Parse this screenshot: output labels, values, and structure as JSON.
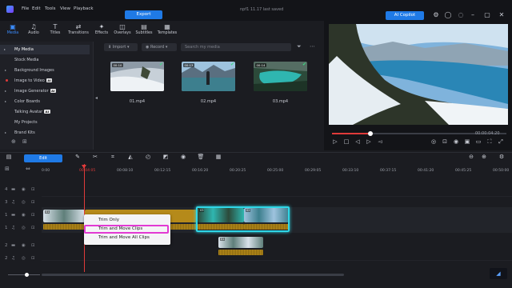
{
  "app": {
    "menu": [
      "File",
      "Edit",
      "Tools",
      "View",
      "Playback"
    ],
    "export_label": "Export",
    "title": "npf1 11.17 last saved",
    "ai_copilot_label": "AI Copilot"
  },
  "toolbar": {
    "tabs": [
      {
        "label": "Media",
        "icon": "media-icon",
        "glyph": "▣"
      },
      {
        "label": "Audio",
        "icon": "audio-icon",
        "glyph": "♫"
      },
      {
        "label": "Titles",
        "icon": "titles-icon",
        "glyph": "T"
      },
      {
        "label": "Transitions",
        "icon": "transitions-icon",
        "glyph": "⇄"
      },
      {
        "label": "Effects",
        "icon": "effects-icon",
        "glyph": "✦"
      },
      {
        "label": "Overlays",
        "icon": "overlays-icon",
        "glyph": "◫"
      },
      {
        "label": "Subtitles",
        "icon": "subtitles-icon",
        "glyph": "▤"
      },
      {
        "label": "Templates",
        "icon": "templates-icon",
        "glyph": "▦"
      }
    ]
  },
  "sidebar": {
    "items": [
      {
        "label": "My Media",
        "active": true,
        "arrow": true
      },
      {
        "label": "Stock Media",
        "active": false,
        "arrow": false
      },
      {
        "label": "Background Images",
        "active": false,
        "arrow": true
      },
      {
        "label": "Image to Video",
        "active": false,
        "arrow": false,
        "ai": true,
        "dot": true
      },
      {
        "label": "Image Generator",
        "active": false,
        "arrow": true,
        "ai": true
      },
      {
        "label": "Color Boards",
        "active": false,
        "arrow": true
      },
      {
        "label": "Talking Avatar",
        "active": false,
        "arrow": false,
        "ai": true
      },
      {
        "label": "My Projects",
        "active": false,
        "arrow": false
      },
      {
        "label": "Brand Kits",
        "active": false,
        "arrow": true
      }
    ],
    "ai_badge": "AI"
  },
  "media": {
    "import_label": "Import",
    "record_label": "Record",
    "search_placeholder": "Search my media",
    "items": [
      {
        "label": "01.mp4",
        "duration": "00:10"
      },
      {
        "label": "02.mp4",
        "duration": "00:13"
      },
      {
        "label": "03.mp4",
        "duration": "00:14"
      }
    ]
  },
  "preview": {
    "current_time": "00:00:04:20",
    "progress": 0.22
  },
  "timeline": {
    "edit_label": "Edit",
    "ruler": [
      "0:00",
      "00:04:05",
      "00:08:10",
      "00:12:15",
      "00:16:20",
      "00:20:25",
      "00:25:00",
      "00:29:05",
      "00:33:10",
      "00:37:15",
      "00:41:20",
      "00:45:25",
      "00:50:00"
    ],
    "clip_labels": [
      "01",
      "03",
      "02",
      "01"
    ]
  },
  "context_menu": {
    "items": [
      "Trim Only",
      "Trim and Move Clips",
      "Trim and Move All Clips"
    ],
    "highlighted_index": 1
  },
  "colors": {
    "accent": "#1f7ae6",
    "playhead": "#e03a3a",
    "selection": "#2fd6e6",
    "menu_highlight": "#e23ad3"
  }
}
